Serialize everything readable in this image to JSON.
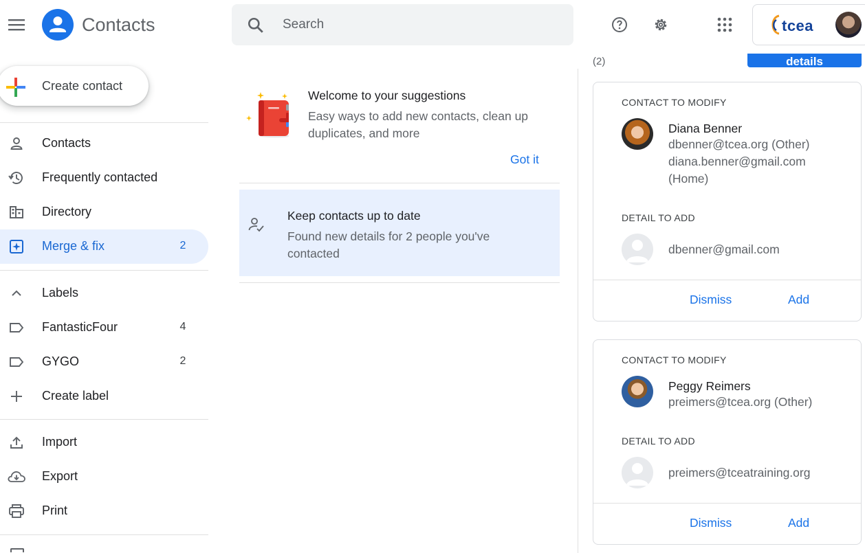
{
  "header": {
    "app_title": "Contacts",
    "search_placeholder": "Search",
    "org_name": "tcea",
    "icons": [
      "menu-icon",
      "contacts-logo-icon",
      "search-icon",
      "help-icon",
      "settings-icon",
      "apps-icon"
    ]
  },
  "sidebar": {
    "create_label": "Create contact",
    "nav": [
      {
        "label": "Contacts",
        "icon": "person-icon"
      },
      {
        "label": "Frequently contacted",
        "icon": "history-icon"
      },
      {
        "label": "Directory",
        "icon": "building-icon"
      },
      {
        "label": "Merge & fix",
        "count": "2",
        "icon": "merge-fix-icon",
        "active": true
      }
    ],
    "labels_header": "Labels",
    "labels": [
      {
        "label": "FantasticFour",
        "count": "4"
      },
      {
        "label": "GYGO",
        "count": "2"
      }
    ],
    "create_label_link": "Create label",
    "tools": [
      {
        "label": "Import",
        "icon": "upload-icon"
      },
      {
        "label": "Export",
        "icon": "cloud-download-icon"
      },
      {
        "label": "Print",
        "icon": "print-icon"
      }
    ]
  },
  "middle": {
    "welcome_title": "Welcome to your suggestions",
    "welcome_desc": "Easy ways to add new contacts, clean up duplicates, and more",
    "got_it": "Got it",
    "uptodate_title": "Keep contacts up to date",
    "uptodate_desc": "Found new details for 2 people you've contacted"
  },
  "right": {
    "count": "(2)",
    "details_btn": "details",
    "cards": [
      {
        "modify_label": "CONTACT TO MODIFY",
        "name": "Diana Benner",
        "lines": [
          "dbenner@tcea.org (Other)",
          "diana.benner@gmail.com",
          "(Home)"
        ],
        "add_label": "DETAIL TO ADD",
        "detail": "dbenner@gmail.com",
        "dismiss": "Dismiss",
        "add": "Add"
      },
      {
        "modify_label": "CONTACT TO MODIFY",
        "name": "Peggy Reimers",
        "lines": [
          "preimers@tcea.org (Other)"
        ],
        "add_label": "DETAIL TO ADD",
        "detail": "preimers@tceatraining.org",
        "dismiss": "Dismiss",
        "add": "Add"
      }
    ]
  },
  "colors": {
    "accent": "#1a73e8",
    "active_bg": "#e8f0fe",
    "text": "#202124",
    "muted": "#5f6368"
  }
}
